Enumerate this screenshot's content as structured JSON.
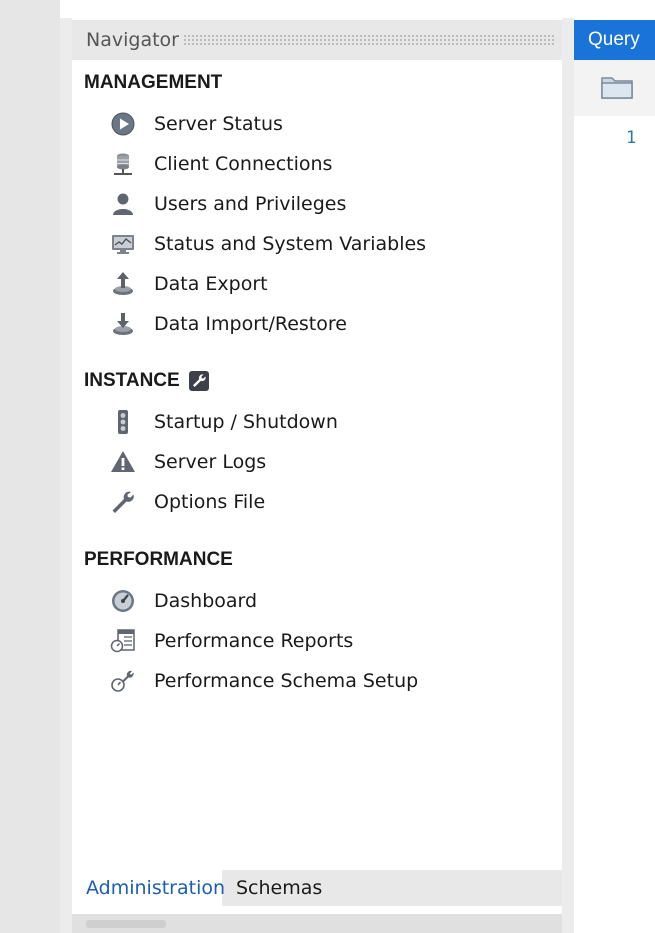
{
  "navigator": {
    "title": "Navigator",
    "sections": {
      "management": {
        "label": "MANAGEMENT",
        "items": [
          {
            "label": "Server Status",
            "icon": "play-circle-icon"
          },
          {
            "label": "Client Connections",
            "icon": "database-connection-icon"
          },
          {
            "label": "Users and Privileges",
            "icon": "user-icon"
          },
          {
            "label": "Status and System Variables",
            "icon": "monitor-icon"
          },
          {
            "label": "Data Export",
            "icon": "export-icon"
          },
          {
            "label": "Data Import/Restore",
            "icon": "import-icon"
          }
        ]
      },
      "instance": {
        "label": "INSTANCE",
        "badge_icon": "wrench-badge-icon",
        "items": [
          {
            "label": "Startup / Shutdown",
            "icon": "traffic-light-icon"
          },
          {
            "label": "Server Logs",
            "icon": "warning-icon"
          },
          {
            "label": "Options File",
            "icon": "wrench-icon"
          }
        ]
      },
      "performance": {
        "label": "PERFORMANCE",
        "items": [
          {
            "label": "Dashboard",
            "icon": "gauge-icon"
          },
          {
            "label": "Performance Reports",
            "icon": "reports-icon"
          },
          {
            "label": "Performance Schema Setup",
            "icon": "schema-setup-icon"
          }
        ]
      }
    },
    "tabs": [
      {
        "label": "Administration",
        "active": true
      },
      {
        "label": "Schemas",
        "active": false
      }
    ]
  },
  "editor": {
    "tab_label": "Query",
    "toolbar_icon": "folder-icon",
    "line_number": "1"
  },
  "colors": {
    "accent": "#1a73d9",
    "active_tab_text": "#1a5fb4",
    "line_number": "#2a7aa8"
  }
}
